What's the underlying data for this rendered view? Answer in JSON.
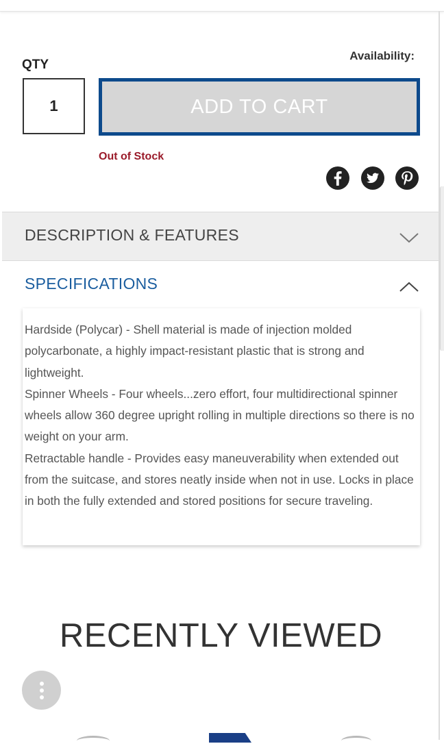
{
  "qty": {
    "label": "QTY",
    "value": "1"
  },
  "availability": {
    "label": "Availability:"
  },
  "add_to_cart": {
    "label": "ADD TO CART"
  },
  "stock_status": "Out of Stock",
  "social": [
    "facebook-icon",
    "twitter-icon",
    "pinterest-icon"
  ],
  "accordion": {
    "description": {
      "title": "DESCRIPTION & FEATURES",
      "expanded": false
    },
    "specifications": {
      "title": "SPECIFICATIONS",
      "expanded": true,
      "paragraphs": [
        "Hardside (Polycar) - Shell material is made of injection molded polycarbonate, a highly impact-resistant plastic that is strong and lightweight.",
        "Spinner Wheels - Four wheels...zero effort, four multidirectional spinner wheels allow 360 degree upright rolling in multiple directions so there is no weight on your arm.",
        "Retractable handle - Provides easy maneuverability when extended out from the suitcase, and stores neatly inside when not in use. Locks in place in both the fully extended and stored positions for secure traveling."
      ]
    }
  },
  "recently_viewed": {
    "title": "RECENTLY VIEWED"
  },
  "colors": {
    "accent": "#0d4a8c",
    "spec_title": "#1a5d9f",
    "out_of_stock": "#9a1b2a",
    "button_bg": "#d6d6d6"
  }
}
